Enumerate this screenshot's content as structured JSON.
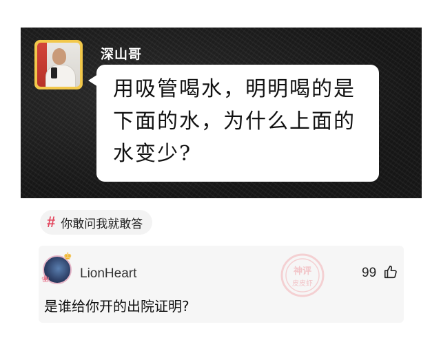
{
  "post": {
    "author": "深山哥",
    "question": "用吸管喝水，明明喝的是\n下面的水，为什么上面的\n水变少?"
  },
  "topic": {
    "icon": "hash-icon",
    "label": "你敢问我就敢答"
  },
  "comment": {
    "username": "LionHeart",
    "likes": "99",
    "text": "是谁给你开的出院证明?",
    "watermark": "神评 皮皮虾"
  },
  "colors": {
    "accent": "#e2445c",
    "banner": "#1c1c1c",
    "avatar_frame": "#f2c84b"
  }
}
